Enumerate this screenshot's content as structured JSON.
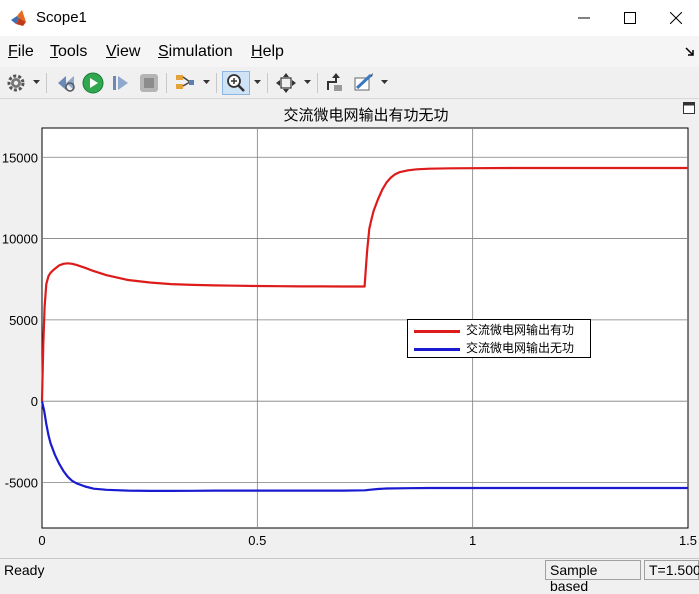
{
  "window": {
    "title": "Scope1"
  },
  "menu": {
    "items": [
      {
        "label": "File",
        "mnemonic": "F",
        "rest": "ile"
      },
      {
        "label": "Tools",
        "mnemonic": "T",
        "rest": "ools"
      },
      {
        "label": "View",
        "mnemonic": "V",
        "rest": "iew"
      },
      {
        "label": "Simulation",
        "mnemonic": "S",
        "rest": "imulation"
      },
      {
        "label": "Help",
        "mnemonic": "H",
        "rest": "elp"
      }
    ]
  },
  "toolbar": {
    "icons": [
      "gear-icon",
      "rewind-icon",
      "run-icon",
      "step-forward-icon",
      "stop-icon",
      "signal-selector-icon",
      "zoom-in-icon",
      "autoscale-icon",
      "highlight-block-icon",
      "style-icon"
    ]
  },
  "status": {
    "text": "Ready",
    "mode": "Sample based",
    "time": "T=1.500"
  },
  "colors": {
    "active_power": "#dd1b1b",
    "reactive_power": "#1a1ad0",
    "plot_bg": "#ffffff",
    "grid": "#7f7f7f"
  },
  "chart_data": {
    "type": "line",
    "title": "交流微电网输出有功无功",
    "xlabel": "",
    "ylabel": "",
    "xlim": [
      0,
      1.5
    ],
    "ylim": [
      -7800,
      16800
    ],
    "xticks": [
      0,
      0.5,
      1,
      1.5
    ],
    "xtick_labels": [
      "0",
      "0.5",
      "1",
      "1.5"
    ],
    "yticks": [
      -5000,
      0,
      5000,
      10000,
      15000
    ],
    "ytick_labels": [
      "-5000",
      "0",
      "5000",
      "10000",
      "15000"
    ],
    "grid": true,
    "legend_position": "center-right",
    "series": [
      {
        "name": "交流微电网输出有功",
        "color": "#dd1b1b",
        "x": [
          0,
          0.003,
          0.006,
          0.01,
          0.015,
          0.02,
          0.03,
          0.04,
          0.05,
          0.06,
          0.07,
          0.08,
          0.1,
          0.12,
          0.15,
          0.2,
          0.25,
          0.3,
          0.35,
          0.4,
          0.45,
          0.5,
          0.55,
          0.6,
          0.65,
          0.7,
          0.749,
          0.752,
          0.755,
          0.76,
          0.765,
          0.77,
          0.78,
          0.79,
          0.8,
          0.81,
          0.82,
          0.83,
          0.85,
          0.87,
          0.9,
          0.95,
          1.0,
          1.1,
          1.2,
          1.3,
          1.4,
          1.5
        ],
        "y": [
          0,
          3500,
          5800,
          7200,
          7700,
          7900,
          8150,
          8350,
          8450,
          8480,
          8450,
          8380,
          8200,
          8000,
          7750,
          7450,
          7300,
          7200,
          7150,
          7120,
          7100,
          7080,
          7070,
          7060,
          7060,
          7050,
          7050,
          8200,
          9300,
          10600,
          11200,
          11700,
          12400,
          13000,
          13450,
          13750,
          13950,
          14080,
          14200,
          14260,
          14300,
          14320,
          14330,
          14340,
          14340,
          14340,
          14340,
          14340
        ]
      },
      {
        "name": "交流微电网输出无功",
        "color": "#1a1ad0",
        "x": [
          0,
          0.005,
          0.01,
          0.015,
          0.02,
          0.03,
          0.04,
          0.05,
          0.06,
          0.07,
          0.08,
          0.1,
          0.12,
          0.15,
          0.2,
          0.25,
          0.3,
          0.35,
          0.4,
          0.45,
          0.5,
          0.55,
          0.6,
          0.65,
          0.7,
          0.75,
          0.76,
          0.78,
          0.8,
          0.85,
          0.9,
          1.0,
          1.1,
          1.2,
          1.3,
          1.4,
          1.5
        ],
        "y": [
          0,
          -600,
          -1400,
          -2100,
          -2600,
          -3300,
          -3850,
          -4300,
          -4650,
          -4900,
          -5050,
          -5250,
          -5380,
          -5450,
          -5500,
          -5520,
          -5520,
          -5510,
          -5500,
          -5500,
          -5500,
          -5500,
          -5500,
          -5500,
          -5500,
          -5480,
          -5450,
          -5400,
          -5370,
          -5350,
          -5340,
          -5340,
          -5340,
          -5340,
          -5340,
          -5340,
          -5340
        ]
      }
    ]
  }
}
